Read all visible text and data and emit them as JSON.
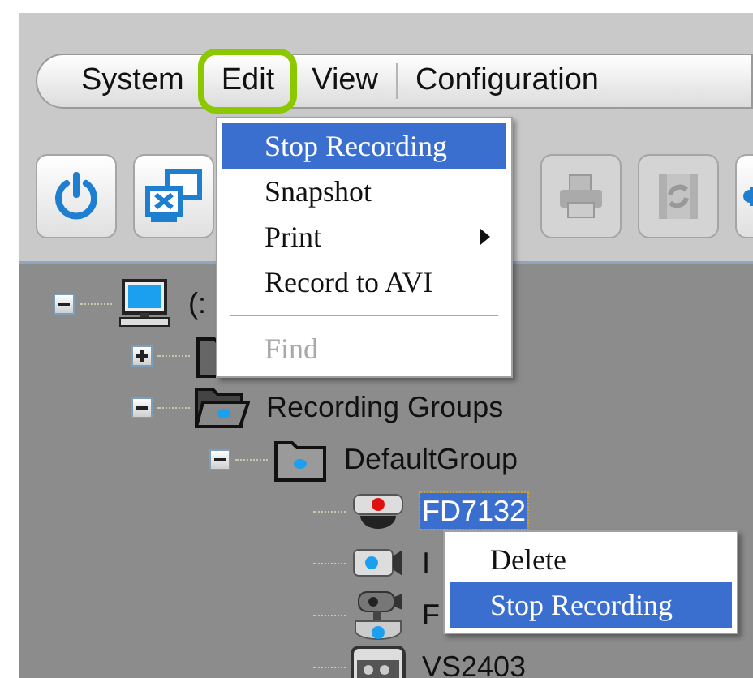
{
  "menu_bar": [
    {
      "label": "System",
      "highlighted": false
    },
    {
      "label": "Edit",
      "highlighted": true
    },
    {
      "label": "View",
      "highlighted": false
    },
    {
      "label": "Configuration",
      "highlighted": false
    }
  ],
  "edit_menu": [
    {
      "kind": "item",
      "label": "Stop Recording",
      "selected": true,
      "disabled": false
    },
    {
      "kind": "item",
      "label": "Snapshot",
      "selected": false,
      "disabled": false
    },
    {
      "kind": "submenu",
      "label": "Print",
      "selected": false,
      "disabled": false
    },
    {
      "kind": "item",
      "label": "Record to AVI",
      "selected": false,
      "disabled": false
    },
    {
      "kind": "separator"
    },
    {
      "kind": "item",
      "label": "Find",
      "selected": false,
      "disabled": true
    }
  ],
  "toolbar": [
    {
      "kind": "power",
      "disabled": false
    },
    {
      "kind": "monitor",
      "disabled": false
    },
    {
      "kind": "gap"
    },
    {
      "kind": "printer",
      "disabled": true
    },
    {
      "kind": "film",
      "disabled": true
    },
    {
      "kind": "puzzle",
      "disabled": false
    }
  ],
  "tree": [
    {
      "kind": "computer",
      "label": "(:",
      "expanded": true,
      "selected": false,
      "children": [
        {
          "kind": "folder",
          "expanded": false
        },
        {
          "kind": "open-folder",
          "label": "Recording Groups",
          "expanded": true,
          "selected": false,
          "children": [
            {
              "kind": "group",
              "label": "DefaultGroup",
              "expanded": true,
              "selected": false,
              "children": [
                {
                  "kind": "dome-camera",
                  "label": "FD7132",
                  "selected": true
                },
                {
                  "kind": "bullet-camera",
                  "label": "I",
                  "selected": false
                },
                {
                  "kind": "ptz-camera",
                  "label": "F",
                  "selected": false
                },
                {
                  "kind": "video-server",
                  "label": "VS2403",
                  "selected": false
                }
              ]
            }
          ]
        }
      ]
    }
  ],
  "context_menu": [
    {
      "label": "Delete",
      "selected": false
    },
    {
      "label": "Stop Recording",
      "selected": true
    }
  ]
}
